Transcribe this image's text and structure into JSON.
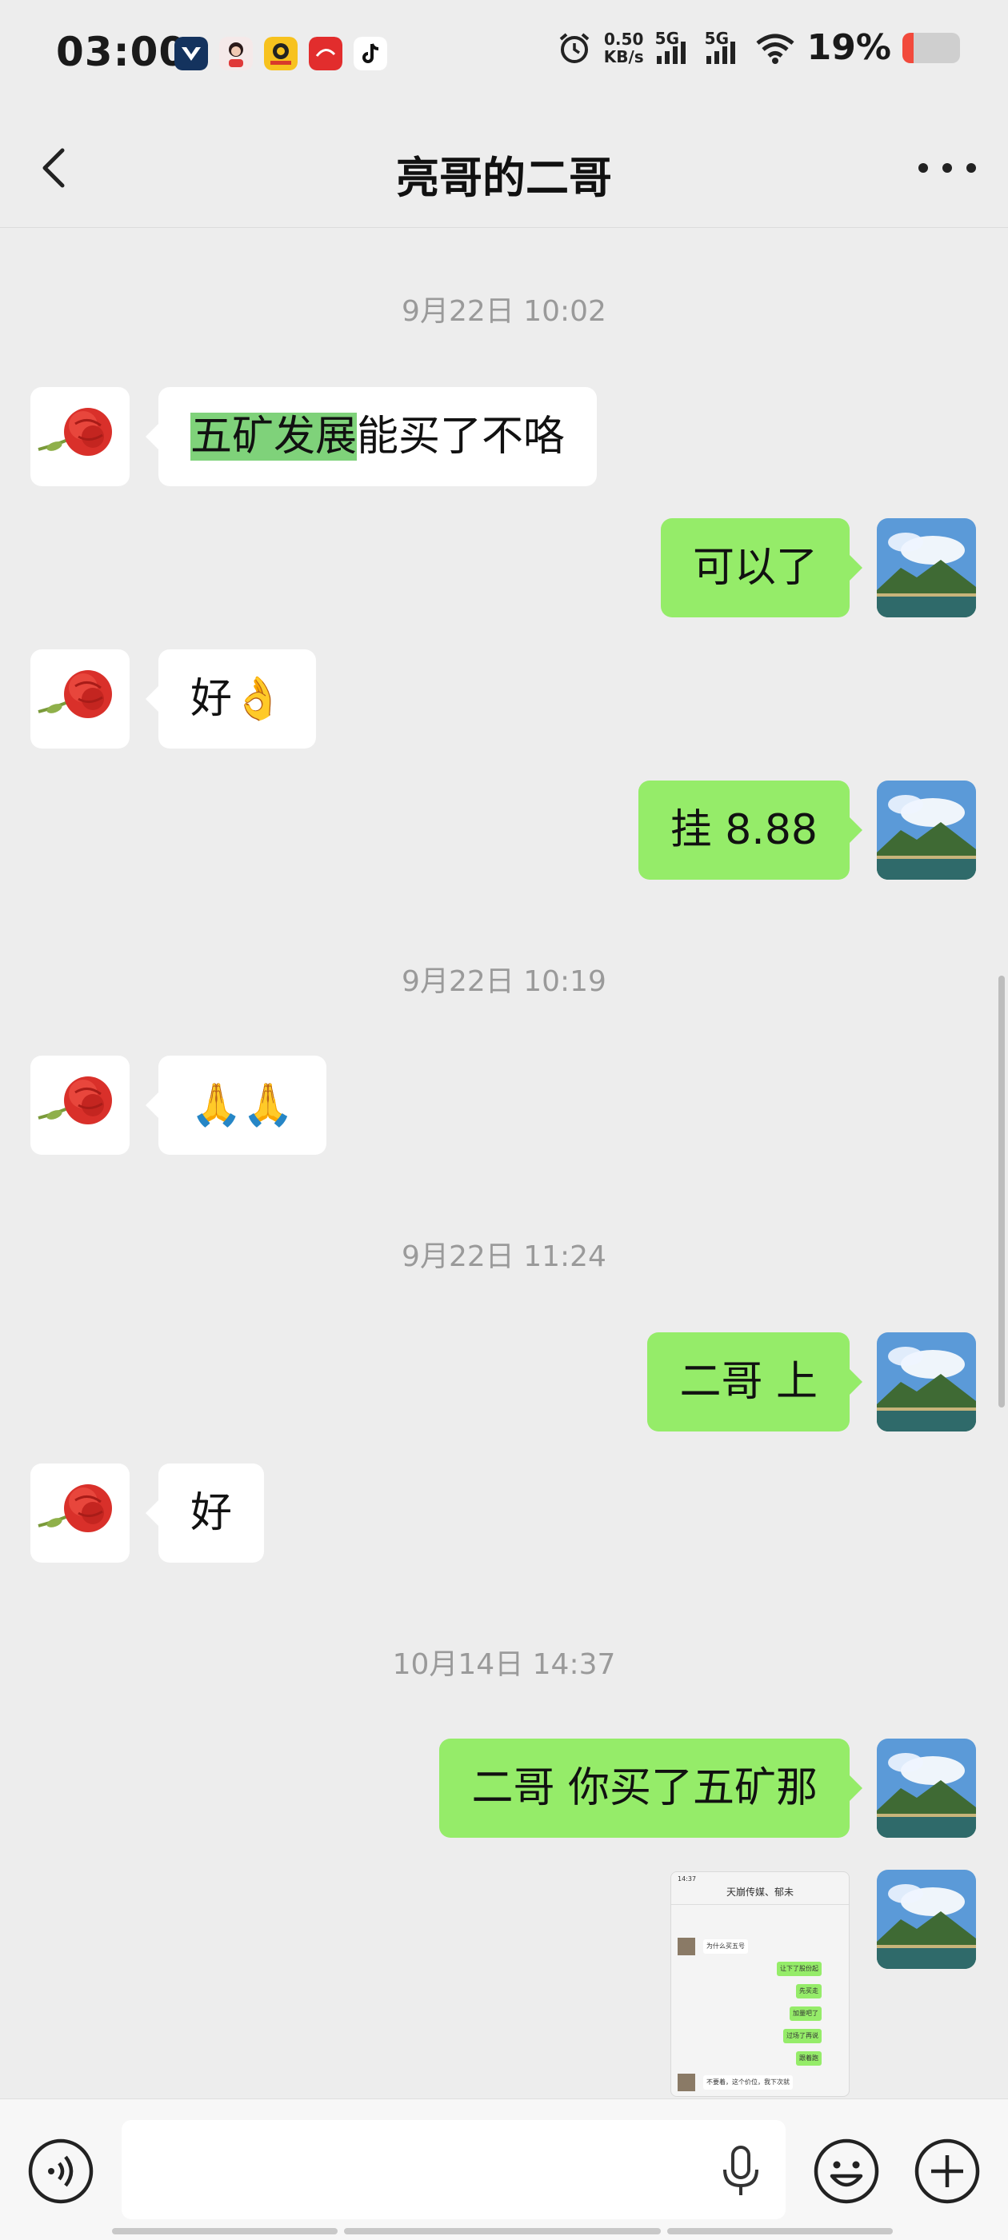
{
  "status_bar": {
    "time": "03:00",
    "net_speed_value": "0.50",
    "net_speed_unit": "KB/s",
    "signal_label_1": "5G",
    "signal_label_2": "5G",
    "battery_percent_text": "19%",
    "battery_level": 0.19,
    "app_icons": [
      "app-v-icon",
      "avatar-app-icon",
      "yellow-app-icon",
      "red-app-icon",
      "tiktok-icon"
    ]
  },
  "header": {
    "title": "亮哥的二哥"
  },
  "messages": [
    {
      "type": "timestamp",
      "text": "9月22日 10:02"
    },
    {
      "type": "incoming",
      "highlight": "五矿发展",
      "rest": "能买了不咯"
    },
    {
      "type": "outgoing",
      "text": "可以了"
    },
    {
      "type": "incoming",
      "text": "好👌"
    },
    {
      "type": "outgoing",
      "text": "挂 8.88"
    },
    {
      "type": "timestamp",
      "text": "9月22日 10:19"
    },
    {
      "type": "incoming",
      "text": "🙏🙏"
    },
    {
      "type": "timestamp",
      "text": "9月22日 11:24"
    },
    {
      "type": "outgoing",
      "text": "二哥 上"
    },
    {
      "type": "incoming",
      "text": "好"
    },
    {
      "type": "timestamp",
      "text": "10月14日 14:37"
    },
    {
      "type": "outgoing",
      "text": "二哥 你买了五矿那"
    },
    {
      "type": "outgoing-image",
      "description": "screenshot"
    }
  ],
  "thumbnail": {
    "status_time": "14:37",
    "title": "天崩传媒、郁未",
    "rows": [
      "为什么买五号",
      "让下了股份起",
      "先买走",
      "加量吧了",
      "过场了再说",
      "跟着跑",
      "不要着，这个价位，我下次就"
    ]
  },
  "input_bar": {
    "placeholder": ""
  },
  "colors": {
    "background": "#ededed",
    "bubble_in": "#ffffff",
    "bubble_out": "#95ec69",
    "highlight": "#7fd27a",
    "timestamp": "#9a9a9a"
  }
}
